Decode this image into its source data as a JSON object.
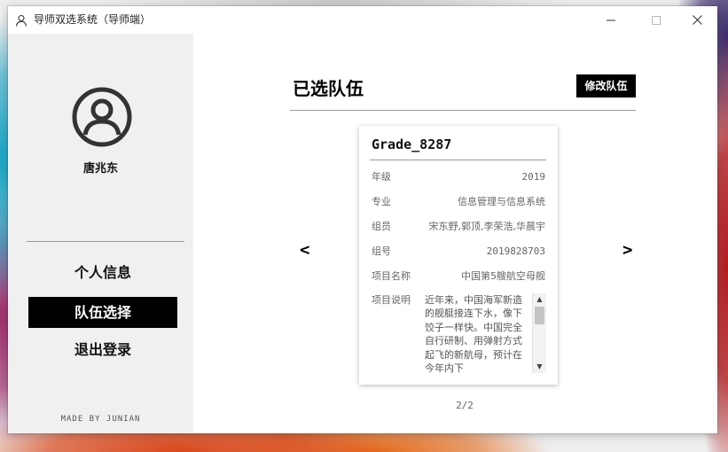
{
  "window": {
    "title": "导师双选系统（导师端）",
    "icons": {
      "app": "user-outline-icon",
      "minimize": "minimize-icon",
      "maximize": "maximize-icon",
      "close": "close-icon"
    }
  },
  "sidebar": {
    "avatar_icon": "user-circle-icon",
    "username": "唐兆东",
    "nav": [
      {
        "label": "个人信息",
        "active": false
      },
      {
        "label": "队伍选择",
        "active": true
      },
      {
        "label": "退出登录",
        "active": false
      }
    ],
    "footer": "MADE BY JUNIAN"
  },
  "main": {
    "title": "已选队伍",
    "edit_button": "修改队伍",
    "prev_arrow": "<",
    "next_arrow": ">",
    "pager": "2/2",
    "team": {
      "name": "Grade_8287",
      "fields": [
        {
          "label": "年级",
          "value": "2019"
        },
        {
          "label": "专业",
          "value": "信息管理与信息系统"
        },
        {
          "label": "组员",
          "value": "宋东野,郭顶,李荣浩,华晨宇"
        },
        {
          "label": "组号",
          "value": "2019828703"
        },
        {
          "label": "项目名称",
          "value": "中国第5艘航空母舰"
        }
      ],
      "description_label": "项目说明",
      "description": "近年来，中国海军新造的舰艇接连下水，像下饺子一样快。中国完全自行研制、用弹射方式起飞的新航母，预计在今年内下"
    }
  },
  "colors": {
    "accent": "#000000",
    "sidebar_bg": "#f0f0f0",
    "muted_text": "#666666"
  }
}
